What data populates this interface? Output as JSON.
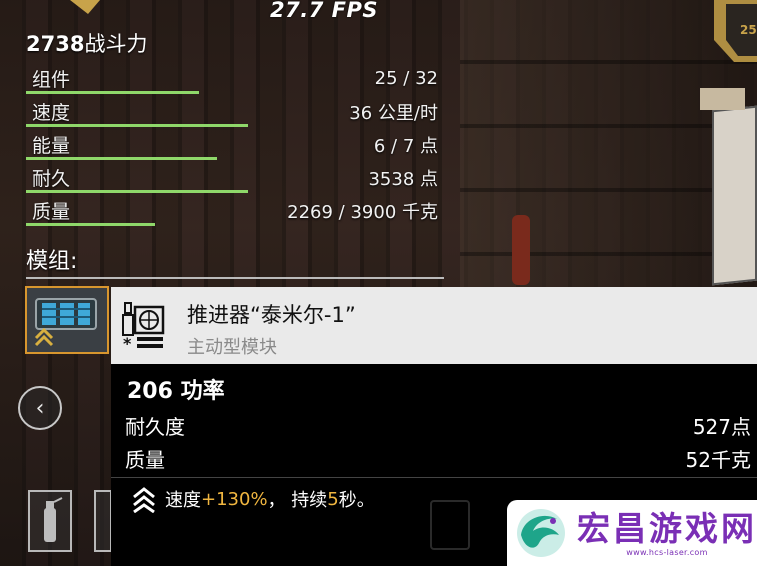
{
  "hud": {
    "fps": "27.7 FPS"
  },
  "power": {
    "value": "2738",
    "suffix": "战斗力"
  },
  "stats": [
    {
      "label": "组件",
      "value": "25 / 32",
      "fill": 0.78
    },
    {
      "label": "速度",
      "value": "36 公里/时",
      "fill": 1.0
    },
    {
      "label": "能量",
      "value": "6 / 7 点",
      "fill": 0.86
    },
    {
      "label": "耐久",
      "value": "3538 点",
      "fill": 1.0
    },
    {
      "label": "质量",
      "value": "2269 / 3900 千克",
      "fill": 0.58
    }
  ],
  "modules": {
    "label": "模组:"
  },
  "card": {
    "name": "推进器“泰米尔-1”",
    "type": "主动型模块",
    "power": "206 功率",
    "rows": [
      {
        "label": "耐久度",
        "value": "527点"
      },
      {
        "label": "质量",
        "value": "52千克"
      }
    ],
    "effect": {
      "pre": "速度",
      "amount": "+130%",
      "mid": "， 持续",
      "seconds": "5",
      "post": "秒。"
    }
  },
  "watermark": {
    "main": "宏昌游戏网",
    "sub": "www.hcs-laser.com"
  },
  "colors": {
    "bar_green": "#8fd86a",
    "slot_border": "#d8962e",
    "highlight": "#f0b640",
    "watermark": "#7a2fb5"
  },
  "icons": [
    "chevron-left-icon",
    "thruster-icon",
    "chevrons-up-icon",
    "radiator-module-icon",
    "fire-extinguisher-icon",
    "dragon-logo-icon"
  ]
}
